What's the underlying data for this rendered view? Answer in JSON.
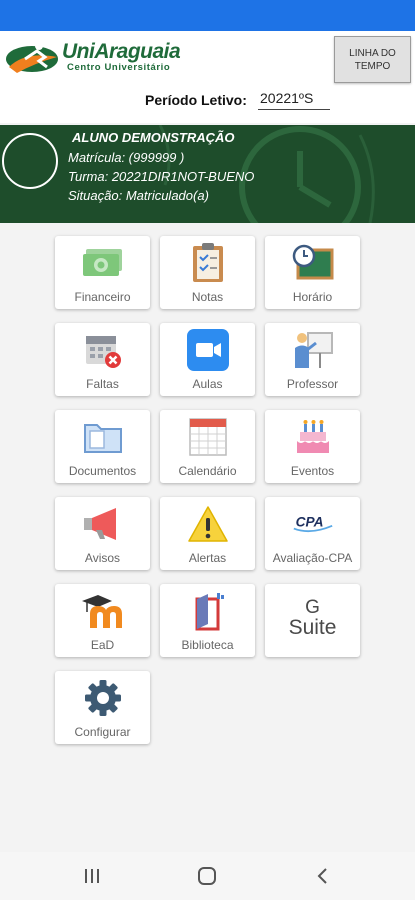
{
  "app": {
    "brand_name": "UniAraguaia",
    "brand_subtitle": "Centro Universitário",
    "timeline_button": "LINHA DO TEMPO"
  },
  "period": {
    "label": "Período Letivo:",
    "value": "20221ºS"
  },
  "student": {
    "name": "ALUNO DEMONSTRAÇÃO",
    "matricula": "Matrícula: (999999 )",
    "turma": "Turma: 20221DIR1NOT-BUENO",
    "situacao": "Situação: Matriculado(a)"
  },
  "menu": [
    {
      "label": "Financeiro",
      "icon": "money-icon"
    },
    {
      "label": "Notas",
      "icon": "clipboard-icon"
    },
    {
      "label": "Horário",
      "icon": "clock-board-icon"
    },
    {
      "label": "Faltas",
      "icon": "calendar-x-icon"
    },
    {
      "label": "Aulas",
      "icon": "video-icon"
    },
    {
      "label": "Professor",
      "icon": "teacher-icon"
    },
    {
      "label": "Documentos",
      "icon": "folder-icon"
    },
    {
      "label": "Calendário",
      "icon": "calendar-icon"
    },
    {
      "label": "Eventos",
      "icon": "cake-icon"
    },
    {
      "label": "Avisos",
      "icon": "megaphone-icon"
    },
    {
      "label": "Alertas",
      "icon": "warning-icon"
    },
    {
      "label": "Avaliação-CPA",
      "icon": "cpa-icon",
      "icon_text": "CPA"
    },
    {
      "label": "EaD",
      "icon": "moodle-icon"
    },
    {
      "label": "Biblioteca",
      "icon": "library-icon"
    },
    {
      "label": "",
      "icon": "gsuite-icon",
      "icon_text": "G",
      "icon_text2": "Suite"
    },
    {
      "label": "Configurar",
      "icon": "gear-icon"
    }
  ],
  "nav": {
    "buttons": [
      "recent-apps-icon",
      "home-icon",
      "back-icon"
    ]
  },
  "colors": {
    "status_bar": "#1e73e6",
    "brand_green": "#1f6b3a",
    "student_bg": "#1e4d2b"
  }
}
